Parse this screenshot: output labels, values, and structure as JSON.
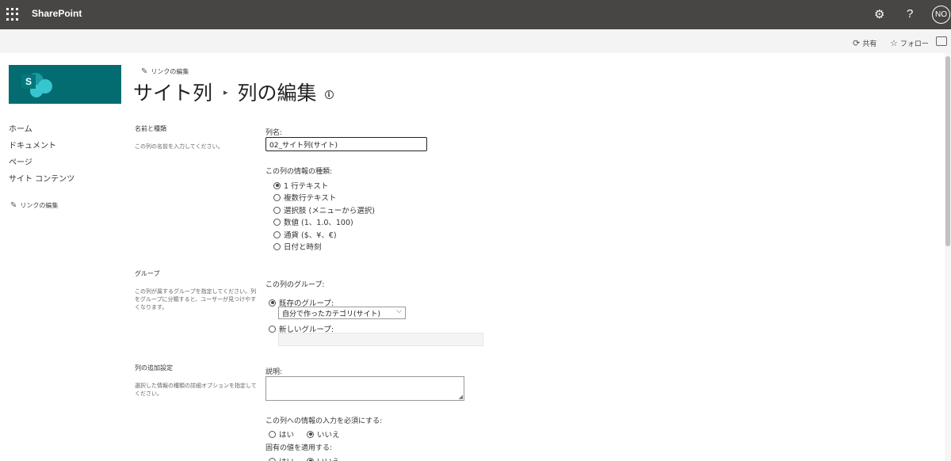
{
  "suitebar": {
    "brand": "SharePoint",
    "settings_glyph": "⚙",
    "help_glyph": "?",
    "avatar_initials": "NO"
  },
  "commandbar": {
    "share_label": "共有",
    "follow_label": "フォロー"
  },
  "logo": {
    "letter": "S"
  },
  "leftnav": {
    "items": [
      {
        "label": "ホーム"
      },
      {
        "label": "ドキュメント"
      },
      {
        "label": "ページ"
      },
      {
        "label": "サイト コンテンツ"
      }
    ],
    "edit_links": "リンクの編集"
  },
  "header": {
    "edit_links": "リンクの編集",
    "breadcrumb_root": "サイト列",
    "breadcrumb_sep": "▸",
    "page_title": "列の編集"
  },
  "section_name": {
    "title": "名前と種類",
    "description": "この列の名前を入力してください。",
    "column_name_label": "列名:",
    "column_name_value": "02_サイト列(サイト)",
    "type_label": "この列の情報の種類:",
    "types": [
      {
        "label": "1 行テキスト",
        "selected": true
      },
      {
        "label": "複数行テキスト",
        "selected": false
      },
      {
        "label": "選択肢 (メニューから選択)",
        "selected": false
      },
      {
        "label": "数値 (1、1.0、100)",
        "selected": false
      },
      {
        "label": "通貨 ($、¥、€)",
        "selected": false
      },
      {
        "label": "日付と時刻",
        "selected": false
      }
    ]
  },
  "section_group": {
    "title": "グループ",
    "description": "この列が属するグループを指定してください。列をグループに分類すると、ユーザーが見つけやすくなります。",
    "group_label": "この列のグループ:",
    "existing_label": "既存のグループ:",
    "existing_value": "自分で作ったカテゴリ(サイト)",
    "new_label": "新しいグループ:"
  },
  "section_additional": {
    "title": "列の追加設定",
    "description": "選択した情報の種類の詳細オプションを指定してください。",
    "description_label": "説明:",
    "required_label": "この列への情報の入力を必須にする:",
    "unique_label": "固有の値を適用する:",
    "yes_label": "はい",
    "no_label": "いいえ"
  }
}
